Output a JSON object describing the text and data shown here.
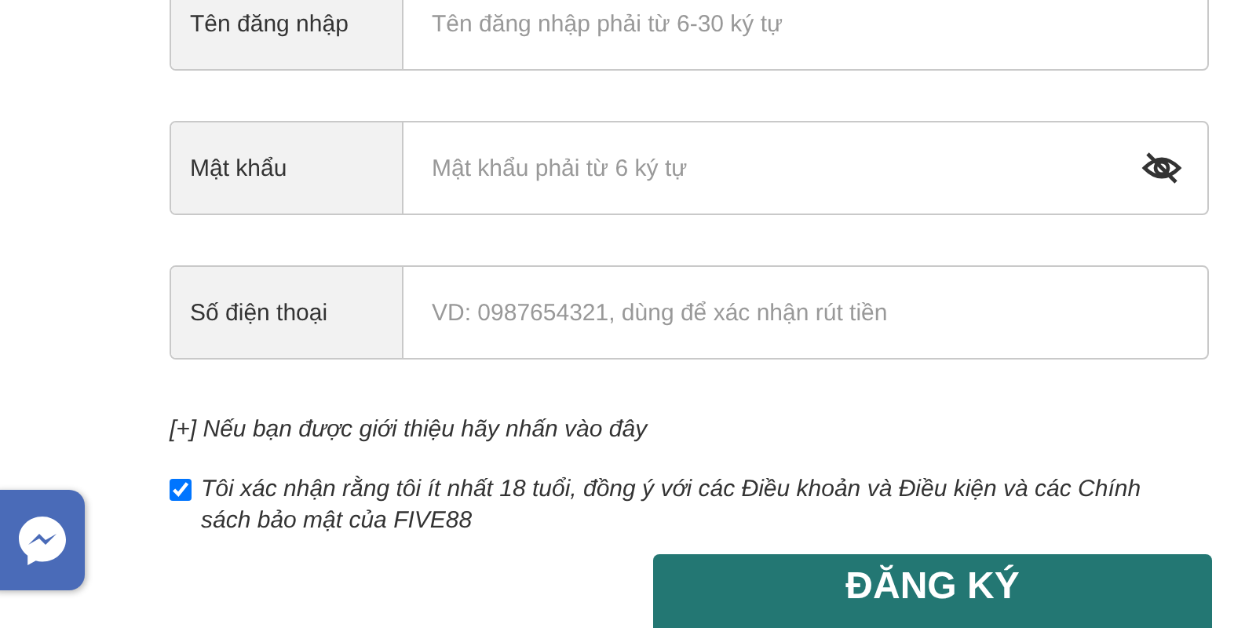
{
  "fields": [
    {
      "label": "Tên đăng nhập",
      "placeholder": "Tên đăng nhập phải từ 6-30 ký tự",
      "kind": "text"
    },
    {
      "label": "Mật khẩu",
      "placeholder": "Mật khẩu phải từ 6 ký tự",
      "kind": "password"
    },
    {
      "label": "Số điện thoại",
      "placeholder": "VD: 0987654321, dùng để xác nhận rút tiền",
      "kind": "text"
    }
  ],
  "referral_link": "[+] Nếu bạn được giới thiệu hãy nhấn vào đây",
  "terms": {
    "checked": true,
    "text": "Tôi xác nhận rằng tôi ít nhất 18 tuổi, đồng ý với các Điều khoản và Điều kiện và các Chính sách bảo mật của FIVE88"
  },
  "submit": "ĐĂNG KÝ"
}
